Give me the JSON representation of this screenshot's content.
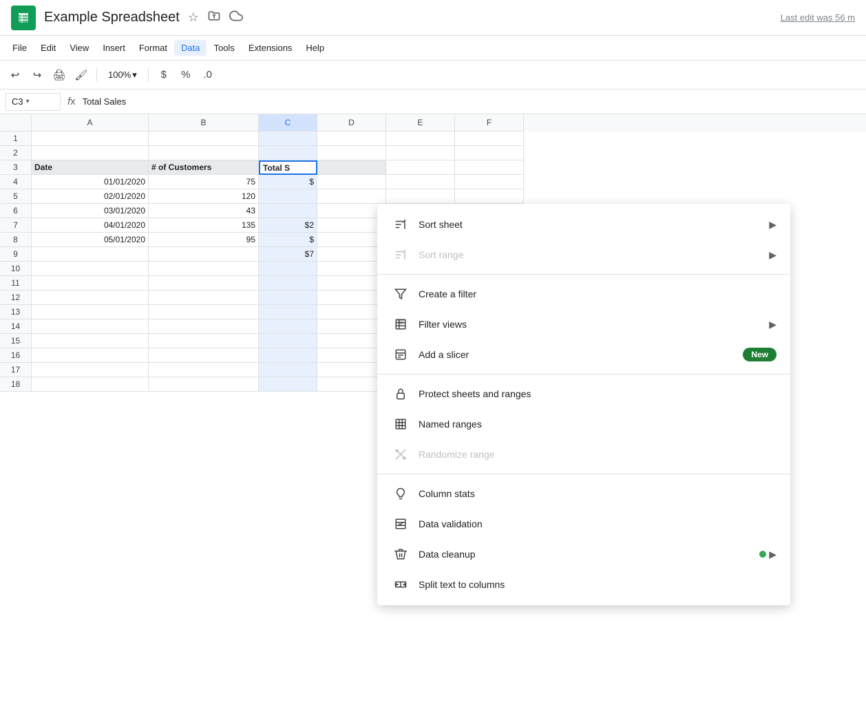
{
  "title_bar": {
    "doc_title": "Example Spreadsheet",
    "last_edit": "Last edit was 56 m",
    "star_icon": "★",
    "folder_icon": "📁",
    "cloud_icon": "☁"
  },
  "menu_bar": {
    "items": [
      {
        "label": "File",
        "active": false
      },
      {
        "label": "Edit",
        "active": false
      },
      {
        "label": "View",
        "active": false
      },
      {
        "label": "Insert",
        "active": false
      },
      {
        "label": "Format",
        "active": false
      },
      {
        "label": "Data",
        "active": true
      },
      {
        "label": "Tools",
        "active": false
      },
      {
        "label": "Extensions",
        "active": false
      },
      {
        "label": "Help",
        "active": false
      }
    ]
  },
  "toolbar": {
    "zoom": "100%",
    "zoom_arrow": "▾"
  },
  "formula_bar": {
    "cell_ref": "C3",
    "formula_text": "Total Sales"
  },
  "columns": {
    "headers": [
      "A",
      "B",
      "C"
    ],
    "widths": [
      170,
      160,
      85
    ]
  },
  "rows": [
    {
      "num": "1",
      "cells": [
        "",
        "",
        ""
      ]
    },
    {
      "num": "2",
      "cells": [
        "",
        "",
        ""
      ]
    },
    {
      "num": "3",
      "cells": [
        "Date",
        "# of Customers",
        "Total S"
      ],
      "bold": true,
      "header": true
    },
    {
      "num": "4",
      "cells": [
        "01/01/2020",
        "75",
        "$"
      ],
      "right": [
        0,
        1,
        2
      ]
    },
    {
      "num": "5",
      "cells": [
        "02/01/2020",
        "120",
        ""
      ]
    },
    {
      "num": "6",
      "cells": [
        "03/01/2020",
        "43",
        ""
      ]
    },
    {
      "num": "7",
      "cells": [
        "04/01/2020",
        "135",
        "$2"
      ],
      "right": [
        0,
        1,
        2
      ]
    },
    {
      "num": "8",
      "cells": [
        "05/01/2020",
        "95",
        "$"
      ],
      "right": [
        0,
        1,
        2
      ]
    },
    {
      "num": "9",
      "cells": [
        "",
        "",
        "$7"
      ],
      "right": [
        2
      ]
    },
    {
      "num": "10",
      "cells": [
        "",
        "",
        ""
      ]
    },
    {
      "num": "11",
      "cells": [
        "",
        "",
        ""
      ]
    },
    {
      "num": "12",
      "cells": [
        "",
        "",
        ""
      ]
    },
    {
      "num": "13",
      "cells": [
        "",
        "",
        ""
      ]
    },
    {
      "num": "14",
      "cells": [
        "",
        "",
        ""
      ]
    },
    {
      "num": "15",
      "cells": [
        "",
        "",
        ""
      ]
    },
    {
      "num": "16",
      "cells": [
        "",
        "",
        ""
      ]
    },
    {
      "num": "17",
      "cells": [
        "",
        "",
        ""
      ]
    },
    {
      "num": "18",
      "cells": [
        "",
        "",
        ""
      ]
    }
  ],
  "dropdown_menu": {
    "items": [
      {
        "id": "sort-sheet",
        "label": "Sort sheet",
        "has_arrow": true,
        "disabled": false,
        "icon_type": "sort"
      },
      {
        "id": "sort-range",
        "label": "Sort range",
        "has_arrow": true,
        "disabled": true,
        "icon_type": "sort"
      },
      {
        "divider": true
      },
      {
        "id": "create-filter",
        "label": "Create a filter",
        "has_arrow": false,
        "disabled": false,
        "icon_type": "filter"
      },
      {
        "id": "filter-views",
        "label": "Filter views",
        "has_arrow": true,
        "disabled": false,
        "icon_type": "filter-views"
      },
      {
        "id": "add-slicer",
        "label": "Add a slicer",
        "has_arrow": false,
        "disabled": false,
        "icon_type": "slicer",
        "badge": "New"
      },
      {
        "divider": true
      },
      {
        "id": "protect-sheets",
        "label": "Protect sheets and ranges",
        "has_arrow": false,
        "disabled": false,
        "icon_type": "lock"
      },
      {
        "id": "named-ranges",
        "label": "Named ranges",
        "has_arrow": false,
        "disabled": false,
        "icon_type": "named-ranges"
      },
      {
        "id": "randomize-range",
        "label": "Randomize range",
        "has_arrow": false,
        "disabled": true,
        "icon_type": "randomize"
      },
      {
        "divider": true
      },
      {
        "id": "column-stats",
        "label": "Column stats",
        "has_arrow": false,
        "disabled": false,
        "icon_type": "bulb"
      },
      {
        "id": "data-validation",
        "label": "Data validation",
        "has_arrow": false,
        "disabled": false,
        "icon_type": "data-validation"
      },
      {
        "id": "data-cleanup",
        "label": "Data cleanup",
        "has_arrow": true,
        "disabled": false,
        "icon_type": "cleanup",
        "has_dot": true
      },
      {
        "id": "split-text",
        "label": "Split text to columns",
        "has_arrow": false,
        "disabled": false,
        "icon_type": "split"
      }
    ],
    "new_label": "New"
  }
}
